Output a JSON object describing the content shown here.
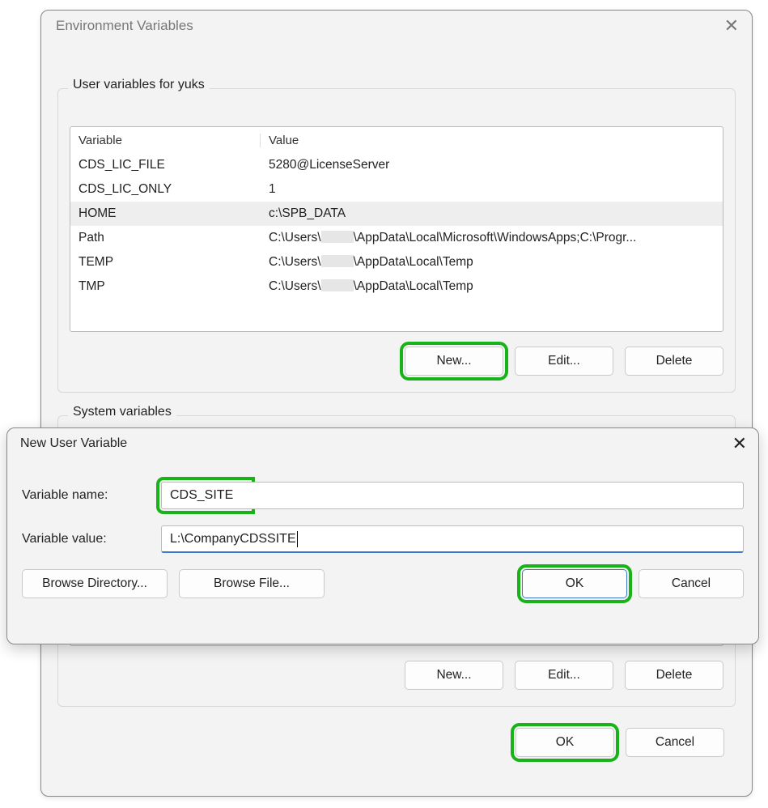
{
  "env_window": {
    "title": "Environment Variables",
    "user_group_label": "User variables for yuks",
    "sys_group_label": "System variables",
    "columns": {
      "var": "Variable",
      "val": "Value"
    },
    "user_vars": [
      {
        "name": "CDS_LIC_FILE",
        "value": "5280@LicenseServer",
        "selected": false
      },
      {
        "name": "CDS_LIC_ONLY",
        "value": "1",
        "selected": false
      },
      {
        "name": "HOME",
        "value": "c:\\SPB_DATA",
        "selected": true
      },
      {
        "name": "Path",
        "value": "C:\\Users\\····\\AppData\\Local\\Microsoft\\WindowsApps;C:\\Progr...",
        "selected": false,
        "redacted_user": true
      },
      {
        "name": "TEMP",
        "value": "C:\\Users\\····\\AppData\\Local\\Temp",
        "selected": false,
        "redacted_user": true
      },
      {
        "name": "TMP",
        "value": "C:\\Users\\····\\AppData\\Local\\Temp",
        "selected": false,
        "redacted_user": true
      }
    ],
    "buttons": {
      "new": "New...",
      "edit": "Edit...",
      "delete": "Delete"
    },
    "bottom_buttons": {
      "ok": "OK",
      "cancel": "Cancel"
    },
    "highlight_color": "#18b318"
  },
  "dlg": {
    "title": "New User Variable",
    "labels": {
      "name": "Variable name:",
      "value": "Variable value:"
    },
    "fields": {
      "name": "CDS_SITE",
      "value": "L:\\CompanyCDSSITE"
    },
    "buttons": {
      "browse_dir": "Browse Directory...",
      "browse_file": "Browse File...",
      "ok": "OK",
      "cancel": "Cancel"
    }
  }
}
